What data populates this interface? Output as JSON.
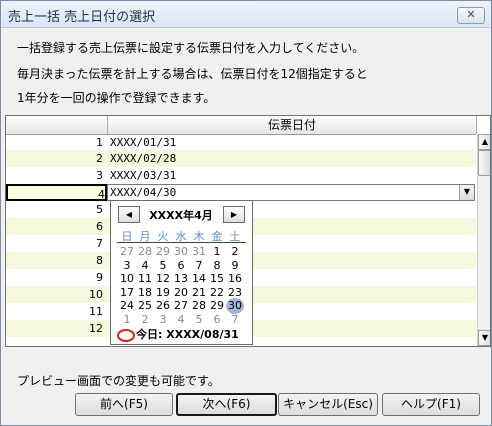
{
  "window": {
    "title": "売上一括 売上日付の選択",
    "close_glyph": "✕"
  },
  "instructions": [
    "一括登録する売上伝票に設定する伝票日付を入力してください。",
    "毎月決まった伝票を計上する場合は、伝票日付を12個指定すると",
    "1年分を一回の操作で登録できます。"
  ],
  "grid": {
    "column_header": "伝票日付",
    "rows": [
      {
        "num": "1",
        "value": "XXXX/01/31"
      },
      {
        "num": "2",
        "value": "XXXX/02/28"
      },
      {
        "num": "3",
        "value": "XXXX/03/31"
      },
      {
        "num": "4",
        "value": "XXXX/04/30"
      },
      {
        "num": "5",
        "value": ""
      },
      {
        "num": "6",
        "value": ""
      },
      {
        "num": "7",
        "value": ""
      },
      {
        "num": "8",
        "value": ""
      },
      {
        "num": "9",
        "value": ""
      },
      {
        "num": "10",
        "value": ""
      },
      {
        "num": "11",
        "value": ""
      },
      {
        "num": "12",
        "value": ""
      }
    ],
    "selected_row": "4"
  },
  "calendar": {
    "month_title": "XXXX年4月",
    "prev_glyph": "◀",
    "next_glyph": "▶",
    "weekdays": [
      "日",
      "月",
      "火",
      "水",
      "木",
      "金",
      "土"
    ],
    "weeks": [
      [
        "27",
        "28",
        "29",
        "30",
        "31",
        "1",
        "2"
      ],
      [
        "3",
        "4",
        "5",
        "6",
        "7",
        "8",
        "9"
      ],
      [
        "10",
        "11",
        "12",
        "13",
        "14",
        "15",
        "16"
      ],
      [
        "17",
        "18",
        "19",
        "20",
        "21",
        "22",
        "23"
      ],
      [
        "24",
        "25",
        "26",
        "27",
        "28",
        "29",
        "30"
      ],
      [
        "1",
        "2",
        "3",
        "4",
        "5",
        "6",
        "7"
      ]
    ],
    "selected_day": "30",
    "today_label": "今日: XXXX/08/31"
  },
  "footer": {
    "note": "プレビュー画面での変更も可能です。",
    "buttons": {
      "prev": "前へ(F5)",
      "next": "次へ(F6)",
      "cancel": "キャンセル(Esc)",
      "help": "ヘルプ(F1)"
    }
  }
}
